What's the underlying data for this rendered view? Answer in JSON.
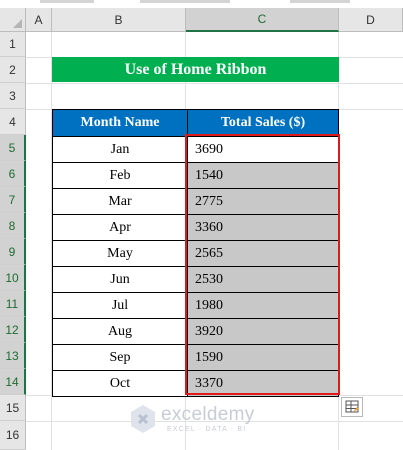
{
  "columns": [
    "A",
    "B",
    "C",
    "D"
  ],
  "selected_column": "C",
  "rows": [
    "1",
    "2",
    "3",
    "4",
    "5",
    "6",
    "7",
    "8",
    "9",
    "10",
    "11",
    "12",
    "13",
    "14",
    "15",
    "16"
  ],
  "title": "Use of Home Ribbon",
  "table": {
    "headers": [
      "Month Name",
      "Total Sales ($)"
    ],
    "rows": [
      {
        "month": "Jan",
        "sales": "3690"
      },
      {
        "month": "Feb",
        "sales": "1540"
      },
      {
        "month": "Mar",
        "sales": "2775"
      },
      {
        "month": "Apr",
        "sales": "3360"
      },
      {
        "month": "May",
        "sales": "2565"
      },
      {
        "month": "Jun",
        "sales": "2530"
      },
      {
        "month": "Jul",
        "sales": "1980"
      },
      {
        "month": "Aug",
        "sales": "3920"
      },
      {
        "month": "Sep",
        "sales": "1590"
      },
      {
        "month": "Oct",
        "sales": "3370"
      }
    ]
  },
  "watermark": {
    "name": "exceldemy",
    "tagline": "EXCEL · DATA · BI"
  },
  "colors": {
    "title_bg": "#00b050",
    "header_bg": "#0070c0",
    "selection_border": "#e0191c",
    "selected_fill": "#c8c8c8"
  }
}
